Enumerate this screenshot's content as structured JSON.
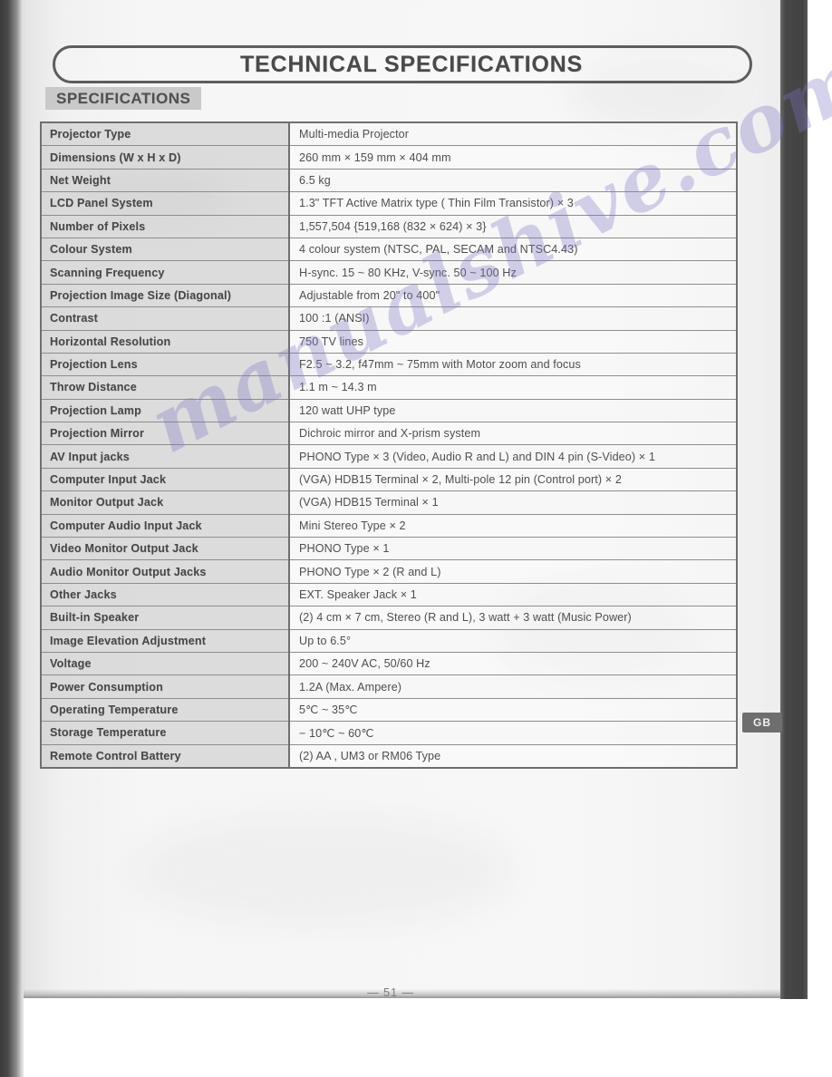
{
  "document": {
    "banner_title": "TECHNICAL SPECIFICATIONS",
    "section_heading": "SPECIFICATIONS",
    "language_badge": "GB",
    "page_number": "— 51 —",
    "watermark_text": "manualshive.com",
    "watermark_color": "#7e76c4",
    "badge_color": "#6e6e6e",
    "rule_color": "#6f6f6f",
    "label_cell_color": "#c4c4c4"
  },
  "spec_table": {
    "rows": [
      {
        "label": "Projector Type",
        "value": "Multi-media Projector"
      },
      {
        "label": "Dimensions (W x H x D)",
        "value": "260 mm × 159 mm × 404 mm"
      },
      {
        "label": "Net Weight",
        "value": "6.5 kg"
      },
      {
        "label": "LCD Panel System",
        "value": "1.3\" TFT Active Matrix type ( Thin Film Transistor) × 3"
      },
      {
        "label": "Number of Pixels",
        "value": "1,557,504 {519,168 (832 × 624) × 3}"
      },
      {
        "label": "Colour System",
        "value": "4 colour system (NTSC, PAL, SECAM and NTSC4.43)"
      },
      {
        "label": "Scanning Frequency",
        "value": "H-sync. 15 ~ 80 KHz, V-sync. 50 ~ 100 Hz"
      },
      {
        "label": "Projection Image Size (Diagonal)",
        "value": "Adjustable from 20\" to 400\""
      },
      {
        "label": "Contrast",
        "value": "100 :1 (ANSI)"
      },
      {
        "label": "Horizontal Resolution",
        "value": "750 TV lines"
      },
      {
        "label": "Projection Lens",
        "value": "F2.5 ~ 3.2, f47mm ~ 75mm  with Motor zoom and focus"
      },
      {
        "label": "Throw Distance",
        "value": "1.1 m ~ 14.3 m"
      },
      {
        "label": "Projection Lamp",
        "value": "120 watt UHP type"
      },
      {
        "label": "Projection Mirror",
        "value": "Dichroic mirror and X-prism system"
      },
      {
        "label": "AV Input jacks",
        "value": "PHONO Type × 3 (Video, Audio R and L) and DIN 4 pin (S-Video) × 1"
      },
      {
        "label": "Computer Input Jack",
        "value": "(VGA) HDB15 Terminal × 2, Multi-pole 12 pin (Control port) × 2"
      },
      {
        "label": "Monitor Output Jack",
        "value": "(VGA) HDB15 Terminal × 1"
      },
      {
        "label": "Computer Audio Input Jack",
        "value": "Mini Stereo Type × 2"
      },
      {
        "label": "Video Monitor Output Jack",
        "value": "PHONO Type × 1"
      },
      {
        "label": "Audio Monitor Output Jacks",
        "value": "PHONO Type × 2 (R and L)"
      },
      {
        "label": "Other Jacks",
        "value": "EXT. Speaker Jack × 1"
      },
      {
        "label": "Built-in Speaker",
        "value": " (2) 4 cm × 7 cm, Stereo (R and L), 3 watt + 3 watt (Music Power)"
      },
      {
        "label": "Image Elevation Adjustment",
        "value": "Up to 6.5°"
      },
      {
        "label": "Voltage",
        "value": "200 ~ 240V AC, 50/60 Hz"
      },
      {
        "label": "Power Consumption",
        "value": "1.2A (Max. Ampere)"
      },
      {
        "label": "Operating Temperature",
        "value": "5℃ ~ 35℃"
      },
      {
        "label": "Storage Temperature",
        "value": "− 10℃ ~ 60℃"
      },
      {
        "label": "Remote Control Battery",
        "value": "(2) AA , UM3 or RM06 Type"
      }
    ]
  }
}
